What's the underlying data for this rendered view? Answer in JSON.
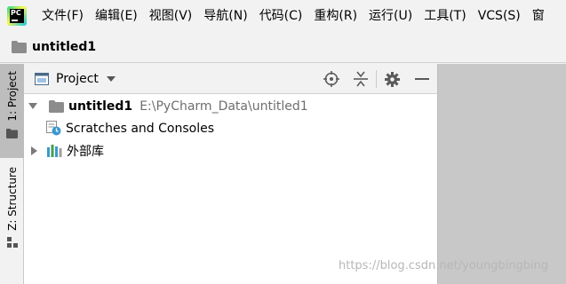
{
  "menu": {
    "items": [
      "文件(F)",
      "编辑(E)",
      "视图(V)",
      "导航(N)",
      "代码(C)",
      "重构(R)",
      "运行(U)",
      "工具(T)",
      "VCS(S)",
      "窗"
    ]
  },
  "app_logo": {
    "text": "PC"
  },
  "navbar": {
    "project_name": "untitled1"
  },
  "tool_strip": {
    "project_tab": "1: Project",
    "structure_tab": "Z: Structure"
  },
  "project_panel": {
    "title": "Project",
    "tree": {
      "root_name": "untitled1",
      "root_path": "E:\\PyCharm_Data\\untitled1",
      "scratches": "Scratches and Consoles",
      "external_libs": "外部库"
    }
  },
  "watermark": "https://blog.csdn.net/youngbingbing",
  "colors": {
    "chrome_bg": "#f2f2f2",
    "panel_bg": "#ffffff",
    "editor_bg": "#c8c8c8",
    "folder_icon": "#8c8c8c",
    "path_text": "#6e6e6e",
    "scratch_badge": "#3c98cf",
    "library_bars": [
      "#3c98cf",
      "#43a047",
      "#9e9e9e"
    ]
  },
  "icons": {
    "view_icon": "project-view-icon",
    "locate": "locate-crosshair-icon",
    "collapse": "collapse-all-icon",
    "settings": "gear-icon",
    "hide": "minimize-icon"
  }
}
